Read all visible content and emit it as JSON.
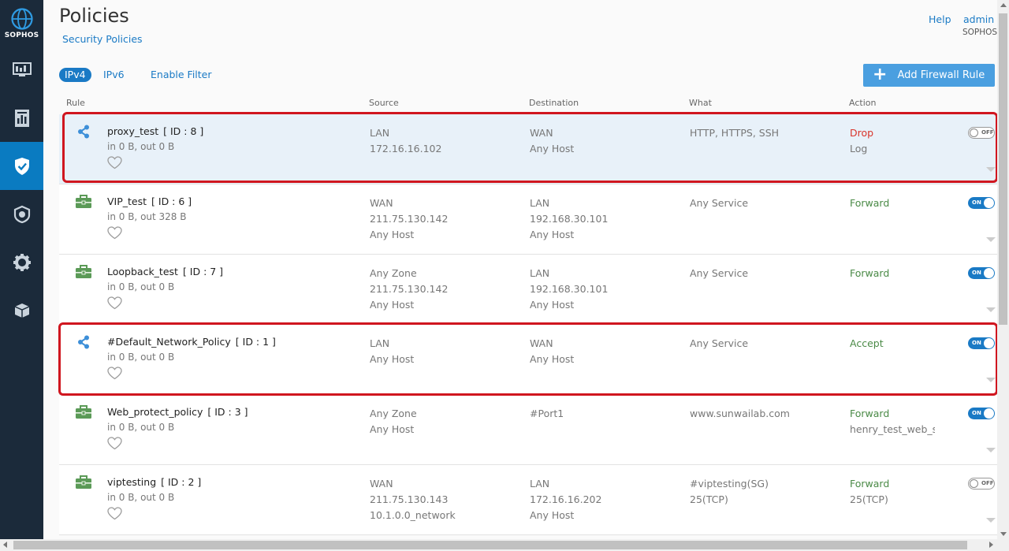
{
  "brand": {
    "logo_text": "SOPHOS"
  },
  "header": {
    "title": "Policies",
    "subtitle": "Security Policies",
    "help": "Help",
    "user": "admin",
    "user_org": "SOPHOS"
  },
  "toolbar": {
    "tab_ipv4": "IPv4",
    "tab_ipv6": "IPv6",
    "enable_filter": "Enable Filter",
    "add_button": "Add Firewall Rule"
  },
  "columns": {
    "rule": "Rule",
    "source": "Source",
    "destination": "Destination",
    "what": "What",
    "action": "Action"
  },
  "sidebar": {
    "items": [
      {
        "icon": "monitor-icon"
      },
      {
        "icon": "report-icon"
      },
      {
        "icon": "shield-check-icon",
        "active": true
      },
      {
        "icon": "protect-icon"
      },
      {
        "icon": "gear-icon"
      },
      {
        "icon": "package-icon"
      }
    ]
  },
  "rows": [
    {
      "name": "proxy_test",
      "id": "[ ID : 8 ]",
      "stats": "in 0 B, out 0 B",
      "source": [
        "LAN",
        "172.16.16.102"
      ],
      "destination": [
        "WAN",
        "Any Host"
      ],
      "what": [
        "HTTP, HTTPS, SSH"
      ],
      "action": [
        "Drop",
        "Log"
      ],
      "toggle": "OFF",
      "icon": "share-icon"
    },
    {
      "name": "VIP_test",
      "id": "[ ID : 6 ]",
      "stats": "in 0 B, out 328 B",
      "source": [
        "WAN",
        "211.75.130.142",
        "Any Host"
      ],
      "destination": [
        "LAN",
        "192.168.30.101",
        "Any Host"
      ],
      "what": [
        "Any Service"
      ],
      "action": [
        "Forward"
      ],
      "toggle": "ON",
      "icon": "briefcase-icon"
    },
    {
      "name": "Loopback_test",
      "id": "[ ID : 7 ]",
      "stats": "in 0 B, out 0 B",
      "source": [
        "Any Zone",
        "211.75.130.142",
        "Any Host"
      ],
      "destination": [
        "LAN",
        "192.168.30.101",
        "Any Host"
      ],
      "what": [
        "Any Service"
      ],
      "action": [
        "Forward"
      ],
      "toggle": "ON",
      "icon": "briefcase-icon"
    },
    {
      "name": "#Default_Network_Policy",
      "id": "[ ID : 1 ]",
      "stats": "in 0 B, out 0 B",
      "source": [
        "LAN",
        "Any Host"
      ],
      "destination": [
        "WAN",
        "Any Host"
      ],
      "what": [
        "Any Service"
      ],
      "action": [
        "Accept"
      ],
      "toggle": "ON",
      "icon": "share-icon"
    },
    {
      "name": "Web_protect_policy",
      "id": "[ ID : 3 ]",
      "stats": "in 0 B, out 0 B",
      "source": [
        "Any Zone",
        "Any Host"
      ],
      "destination": [
        "#Port1"
      ],
      "what": [
        "www.sunwailab.com"
      ],
      "action": [
        "Forward",
        "henry_test_web_se"
      ],
      "toggle": "ON",
      "icon": "briefcase-icon"
    },
    {
      "name": "viptesting",
      "id": "[ ID : 2 ]",
      "stats": "in 0 B, out 0 B",
      "source": [
        "WAN",
        "211.75.130.143",
        "10.1.0.0_network"
      ],
      "destination": [
        "LAN",
        "172.16.16.202",
        "Any Host"
      ],
      "what": [
        "#viptesting(SG)",
        "25(TCP)"
      ],
      "action": [
        "Forward",
        "25(TCP)"
      ],
      "toggle": "OFF",
      "icon": "briefcase-icon"
    }
  ],
  "colors": {
    "accent": "#1a7ac5",
    "sidebar": "#1b2a3a",
    "drop": "#d9342b",
    "forward": "#4a8a46",
    "highlight": "#d0161f"
  }
}
